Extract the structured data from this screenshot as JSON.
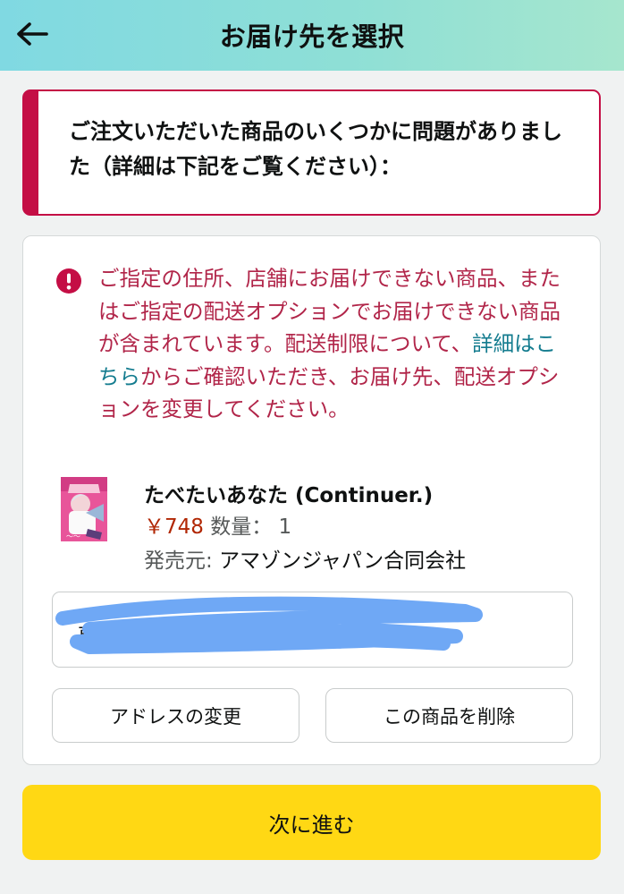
{
  "header": {
    "back_icon": "arrow-left-icon",
    "title": "お届け先を選択"
  },
  "alert": {
    "message": "ご注文いただいた商品のいくつかに問題がありました（詳細は下記をご覧ください）："
  },
  "card": {
    "error_icon": "exclamation-circle-icon",
    "error_before": "ご指定の住所、店舗にお届けできない商品、またはご指定の配送オプションでお届けできない商品が含まれています。配送制限について、",
    "error_link": "詳細はこちら",
    "error_after": "からご確認いただき、お届け先、配送オプションを変更してください。",
    "product": {
      "title": "たべたいあなた (Continuer.)",
      "price": "￥748",
      "quantity_label": "数量：",
      "quantity": "1",
      "seller_label": "発売元:",
      "seller": "アマゾンジャパン合同会社"
    },
    "address": {
      "visible_fragment": "東"
    },
    "change_address_label": "アドレスの変更",
    "delete_item_label": "この商品を削除"
  },
  "next_button_label": "次に進む",
  "colors": {
    "header_gradient_start": "#80d9e2",
    "header_gradient_end": "#a6e6ce",
    "alert_red": "#c40e45",
    "error_text": "#b12549",
    "link": "#147c8f",
    "price": "#b12704",
    "primary_button": "#ffd814",
    "redaction_scribble": "#6fa8f5"
  }
}
